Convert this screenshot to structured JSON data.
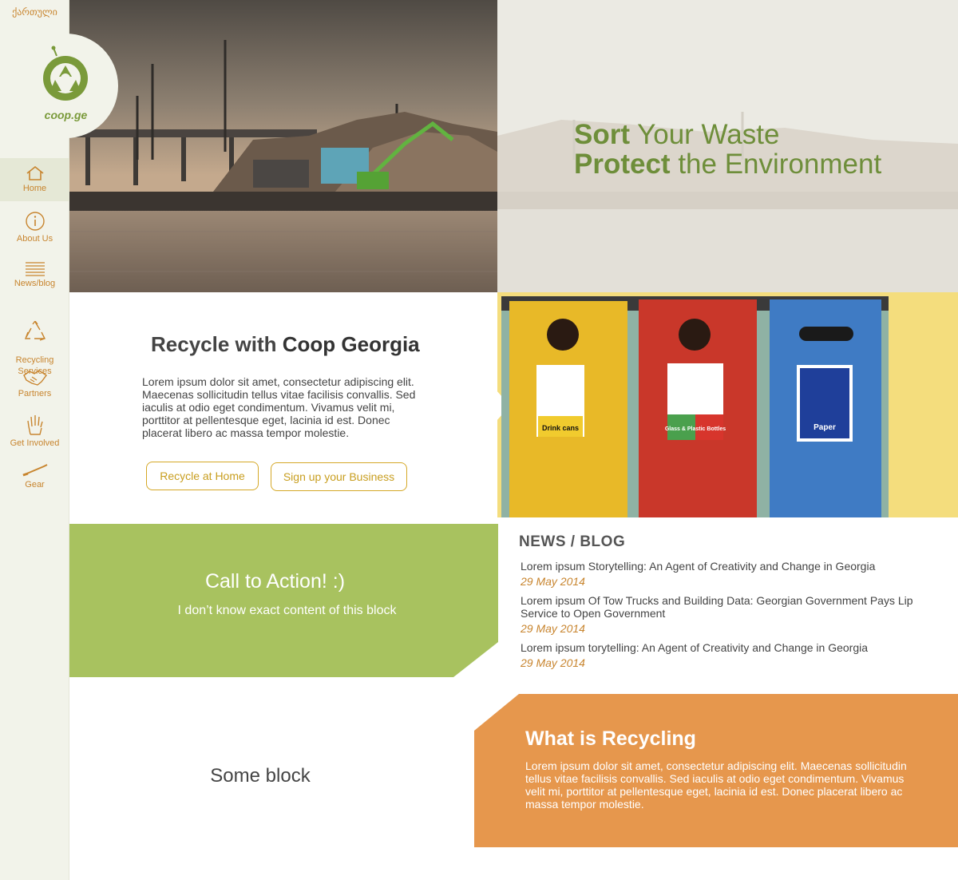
{
  "sidebar": {
    "language": "ქართული",
    "logo_text": "coop.ge",
    "items": [
      {
        "label": "Home",
        "icon": "home-icon"
      },
      {
        "label": "About Us",
        "icon": "info-icon"
      },
      {
        "label": "News/blog",
        "icon": "lines-icon"
      },
      {
        "label": "Recycling\nServices",
        "icon": "recycle-icon"
      },
      {
        "label": "Partners",
        "icon": "handshake-icon"
      },
      {
        "label": "Get Involved",
        "icon": "hand-icon"
      },
      {
        "label": "Gear",
        "icon": "tool-icon"
      }
    ]
  },
  "hero": {
    "line1_bold": "Sort",
    "line1_rest": " Your Waste",
    "line2_bold": "Protect",
    "line2_rest": " the Environment"
  },
  "recycle": {
    "title_prefix": "Recycle with ",
    "title_bold": "Coop Georgia",
    "body": "Lorem ipsum dolor sit amet, consectetur adipiscing elit. Maecenas sollicitudin tellus vitae facilisis convallis. Sed iaculis at odio eget condimentum. Vivamus velit mi, porttitor at pellentesque eget, lacinia id est. Donec placerat libero ac massa tempor molestie.",
    "button_home": "Recycle at Home",
    "button_business": "Sign up your Business"
  },
  "bins": {
    "labels": [
      "Drink cans",
      "Glass & Plastic Bottles",
      "Paper"
    ]
  },
  "cta": {
    "title": "Call to Action! :)",
    "subtitle": "I don’t know exact content of this block"
  },
  "news": {
    "heading": "NEWS / BLOG",
    "items": [
      {
        "title": "Lorem ipsum Storytelling: An Agent of Creativity and Change in Georgia",
        "date": "29 May 2014"
      },
      {
        "title": "Lorem ipsum Of Tow Trucks and Building Data: Georgian Government Pays Lip Service to Open Government",
        "date": "29 May 2014"
      },
      {
        "title": "Lorem ipsum torytelling: An Agent of Creativity and Change in Georgia",
        "date": "29 May 2014"
      }
    ]
  },
  "some_block": {
    "title": "Some block"
  },
  "what": {
    "title": "What is Recycling",
    "body": "Lorem ipsum dolor sit amet, consectetur adipiscing elit. Maecenas sollicitudin tellus vitae facilisis convallis. Sed iaculis at odio eget condimentum. Vivamus velit mi, porttitor at pellentesque eget, lacinia id est. Donec placerat libero ac massa tempor molestie."
  },
  "colors": {
    "accent_orange": "#e6974d",
    "accent_green": "#a8c25f",
    "accent_yellow": "#f4dd7d",
    "brand_green": "#6e8e3a",
    "nav_text": "#c8852f"
  }
}
